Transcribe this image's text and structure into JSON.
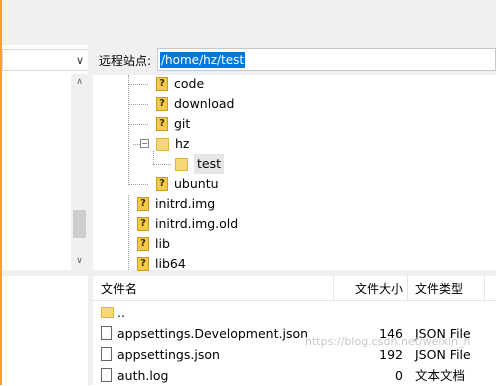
{
  "remote_site": {
    "label": "远程站点:",
    "path": "/home/hz/test"
  },
  "tree": {
    "items": [
      {
        "label": "code",
        "icon": "question-folder-icon"
      },
      {
        "label": "download",
        "icon": "question-folder-icon"
      },
      {
        "label": "git",
        "icon": "question-folder-icon"
      },
      {
        "label": "hz",
        "icon": "folder-icon",
        "expanded": true,
        "expander": "−"
      },
      {
        "label": "test",
        "icon": "folder-icon",
        "selected": true
      },
      {
        "label": "ubuntu",
        "icon": "question-folder-icon"
      },
      {
        "label": "initrd.img",
        "icon": "question-folder-icon"
      },
      {
        "label": "initrd.img.old",
        "icon": "question-folder-icon"
      },
      {
        "label": "lib",
        "icon": "question-folder-icon"
      },
      {
        "label": "lib64",
        "icon": "question-folder-icon"
      }
    ]
  },
  "file_list": {
    "columns": [
      "文件名",
      "文件大小",
      "文件类型"
    ],
    "rows": [
      {
        "name": "..",
        "size": "",
        "type": "",
        "icon": "folder-icon"
      },
      {
        "name": "appsettings.Development.json",
        "size": "146",
        "type": "JSON File",
        "icon": "json-file-icon"
      },
      {
        "name": "appsettings.json",
        "size": "192",
        "type": "JSON File",
        "icon": "json-file-icon"
      },
      {
        "name": "auth.log",
        "size": "0",
        "type": "文本文档",
        "icon": "text-file-icon"
      }
    ]
  },
  "scroll": {
    "up": "∧",
    "down": "∨",
    "dropdown": "∨"
  },
  "watermark": "https://blog.csdn.net/weixin_h",
  "colors": {
    "selection": "#0078d7",
    "accent_edge": "#f3a425",
    "folder": "#f8d775"
  }
}
